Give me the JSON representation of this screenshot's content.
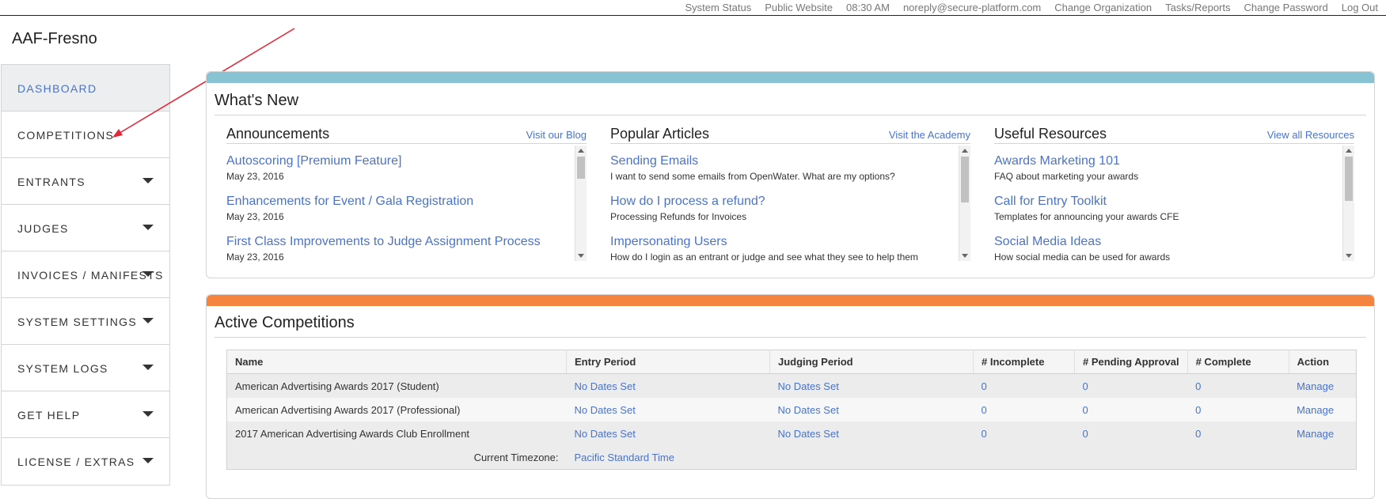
{
  "topbar": {
    "links": [
      "System Status",
      "Public Website",
      "08:30 AM",
      "noreply@secure-platform.com",
      "Change Organization",
      "Tasks/Reports",
      "Change Password",
      "Log Out"
    ]
  },
  "org": {
    "title": "AAF-Fresno"
  },
  "sidebar": {
    "items": [
      {
        "label": "DASHBOARD"
      },
      {
        "label": "COMPETITIONS"
      },
      {
        "label": "ENTRANTS"
      },
      {
        "label": "JUDGES"
      },
      {
        "label": "INVOICES / MANIFESTS"
      },
      {
        "label": "SYSTEM SETTINGS"
      },
      {
        "label": "SYSTEM LOGS"
      },
      {
        "label": "GET HELP"
      },
      {
        "label": "LICENSE / EXTRAS"
      }
    ]
  },
  "colors": {
    "whats_new_band": "#88c3d3",
    "active_band": "#f5843e",
    "link": "#4a73c9"
  },
  "whats_new": {
    "title": "What's New",
    "columns": [
      {
        "title": "Announcements",
        "more": "Visit our Blog",
        "items": [
          {
            "title": "Autoscoring [Premium Feature]",
            "sub": "May 23, 2016"
          },
          {
            "title": "Enhancements for Event / Gala Registration",
            "sub": "May 23, 2016"
          },
          {
            "title": "First Class Improvements to Judge Assignment Process",
            "sub": "May 23, 2016"
          }
        ]
      },
      {
        "title": "Popular Articles",
        "more": "Visit the Academy",
        "items": [
          {
            "title": "Sending Emails",
            "sub": "I want to send some emails from OpenWater. What are my options?"
          },
          {
            "title": "How do I process a refund?",
            "sub": "Processing Refunds for Invoices"
          },
          {
            "title": "Impersonating Users",
            "sub": "How do I login as an entrant or judge and see what they see to help them"
          }
        ]
      },
      {
        "title": "Useful Resources",
        "more": "View all Resources",
        "items": [
          {
            "title": "Awards Marketing 101",
            "sub": "FAQ about marketing your awards"
          },
          {
            "title": "Call for Entry Toolkit",
            "sub": "Templates for announcing your awards CFE"
          },
          {
            "title": "Social Media Ideas",
            "sub": "How social media can be used for awards"
          }
        ]
      }
    ]
  },
  "active": {
    "title": "Active Competitions",
    "headers": [
      "Name",
      "Entry Period",
      "Judging Period",
      "# Incomplete",
      "# Pending Approval",
      "# Complete",
      "Action"
    ],
    "rows": [
      [
        "American Advertising Awards 2017 (Student)",
        "No Dates Set",
        "No Dates Set",
        "0",
        "0",
        "0",
        "Manage"
      ],
      [
        "American Advertising Awards 2017 (Professional)",
        "No Dates Set",
        "No Dates Set",
        "0",
        "0",
        "0",
        "Manage"
      ],
      [
        "2017 American Advertising Awards Club Enrollment",
        "No Dates Set",
        "No Dates Set",
        "0",
        "0",
        "0",
        "Manage"
      ]
    ],
    "timezone_label": "Current Timezone:",
    "timezone_value": "Pacific Standard Time"
  }
}
